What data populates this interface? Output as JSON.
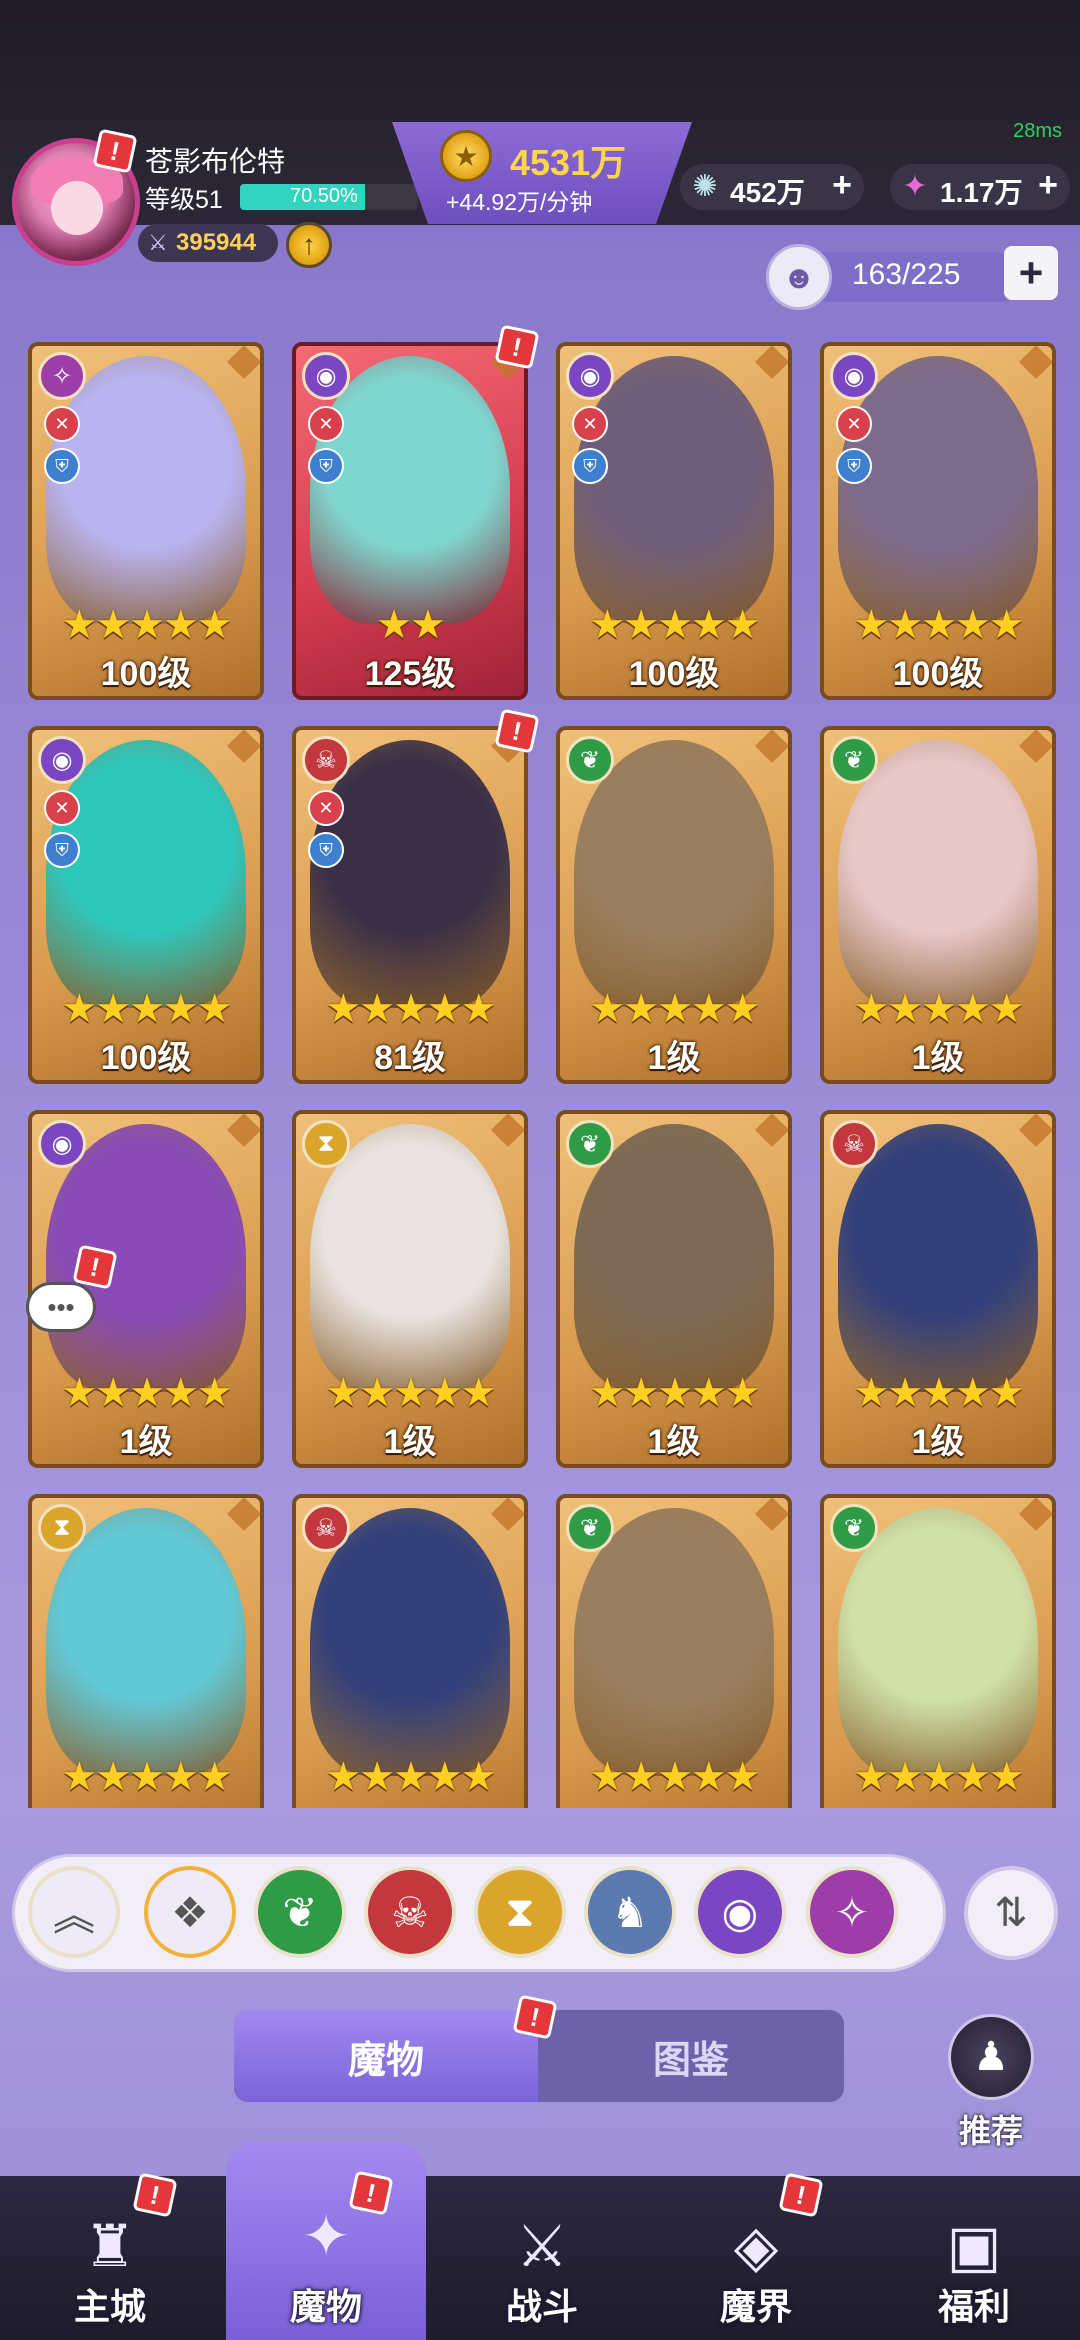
{
  "status": {
    "ping": "28ms"
  },
  "player": {
    "name": "苍影布伦特",
    "level_label": "等级51",
    "xp_percent_text": "70.50%",
    "xp_fraction": 0.705,
    "power": "395944"
  },
  "currencies": {
    "gold_amount": "4531万",
    "gold_rate": "+44.92万/分钟",
    "gems": "452万",
    "stars": "1.17万"
  },
  "inventory": {
    "capacity": "163/225"
  },
  "cards": [
    {
      "level": "100级",
      "stars": 5,
      "element": "spark-element-icon",
      "theme": "gold",
      "art": "#b9b3f0"
    },
    {
      "level": "125级",
      "stars": 2,
      "element": "eye-element-icon",
      "theme": "red",
      "art": "#7fd6cf"
    },
    {
      "level": "100级",
      "stars": 5,
      "element": "eye-element-icon",
      "theme": "gold",
      "art": "#6f5e7a"
    },
    {
      "level": "100级",
      "stars": 5,
      "element": "eye-element-icon",
      "theme": "gold",
      "art": "#7d6b8e"
    },
    {
      "level": "100级",
      "stars": 5,
      "element": "eye-element-icon",
      "theme": "gold",
      "art": "#2ec7bb"
    },
    {
      "level": "81级",
      "stars": 5,
      "element": "demon-element-icon",
      "theme": "gold",
      "art": "#3a2f46"
    },
    {
      "level": "1级",
      "stars": 5,
      "element": "leaf-element-icon",
      "theme": "gold",
      "art": "#9a7f60"
    },
    {
      "level": "1级",
      "stars": 5,
      "element": "leaf-element-icon",
      "theme": "gold",
      "art": "#e8c7c9"
    },
    {
      "level": "1级",
      "stars": 5,
      "element": "eye-element-icon",
      "theme": "gold",
      "art": "#8a4bb7"
    },
    {
      "level": "1级",
      "stars": 5,
      "element": "hourglass-element-icon",
      "theme": "gold",
      "art": "#e9e4e2"
    },
    {
      "level": "1级",
      "stars": 5,
      "element": "leaf-element-icon",
      "theme": "gold",
      "art": "#7c6a55"
    },
    {
      "level": "1级",
      "stars": 5,
      "element": "demon-element-icon",
      "theme": "gold",
      "art": "#33407a"
    },
    {
      "level": "",
      "stars": 5,
      "element": "hourglass-element-icon",
      "theme": "gold",
      "art": "#62c9d6"
    },
    {
      "level": "",
      "stars": 5,
      "element": "demon-element-icon",
      "theme": "gold",
      "art": "#33407a"
    },
    {
      "level": "",
      "stars": 5,
      "element": "leaf-element-icon",
      "theme": "gold",
      "art": "#9a7f60"
    },
    {
      "level": "",
      "stars": 5,
      "element": "leaf-element-icon",
      "theme": "gold",
      "art": "#cfe1a8"
    }
  ],
  "filters": [
    {
      "name": "collapse-filter-button",
      "glyph": "︽",
      "color": "#eeeaf6",
      "fg": "#555"
    },
    {
      "name": "all-filter-button",
      "glyph": "❖",
      "color": "#eeeaf6",
      "fg": "#555"
    },
    {
      "name": "leaf-filter-button",
      "glyph": "❦",
      "color": "#2f9b46",
      "fg": "#fff"
    },
    {
      "name": "demon-filter-button",
      "glyph": "☠",
      "color": "#c2383d",
      "fg": "#fff"
    },
    {
      "name": "hourglass-filter-button",
      "glyph": "⧗",
      "color": "#d9a62b",
      "fg": "#fff"
    },
    {
      "name": "dragon-filter-button",
      "glyph": "♞",
      "color": "#5d7ab0",
      "fg": "#fff"
    },
    {
      "name": "eye-filter-button",
      "glyph": "◉",
      "color": "#7a46c2",
      "fg": "#fff"
    },
    {
      "name": "spark-filter-button",
      "glyph": "✧",
      "color": "#9d3ea8",
      "fg": "#fff"
    }
  ],
  "tabs": {
    "monsters": "魔物",
    "codex": "图鉴"
  },
  "recommend_label": "推荐",
  "nav": [
    {
      "label": "主城",
      "icon": "castle-icon",
      "glyph": "♜"
    },
    {
      "label": "魔物",
      "icon": "monster-flame-icon",
      "glyph": "✦"
    },
    {
      "label": "战斗",
      "icon": "battle-shield-icon",
      "glyph": "⚔"
    },
    {
      "label": "魔界",
      "icon": "portal-icon",
      "glyph": "◈"
    },
    {
      "label": "福利",
      "icon": "treasure-chest-icon",
      "glyph": "▣"
    }
  ],
  "colors": {
    "accent": "#8b79cc",
    "gold": "#ffd64a",
    "star": "#ffcf24"
  }
}
